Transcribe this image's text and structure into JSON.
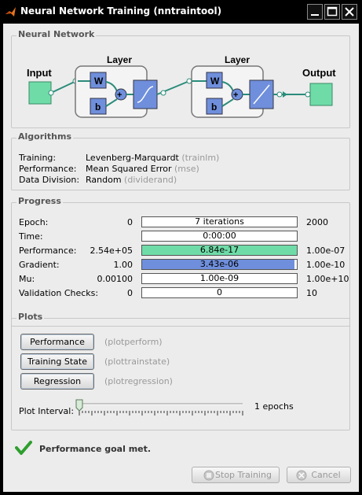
{
  "window": {
    "title": "Neural Network Training (nntraintool)"
  },
  "network": {
    "legend": "Neural Network",
    "input_label": "Input",
    "output_label": "Output",
    "layer1_label": "Layer",
    "layer2_label": "Layer",
    "weight_label": "W",
    "bias_label": "b"
  },
  "algorithms": {
    "legend": "Algorithms",
    "rows": [
      {
        "label": "Training:",
        "value": "Levenberg-Marquardt",
        "code": "(trainlm)"
      },
      {
        "label": "Performance:",
        "value": "Mean Squared Error",
        "code": "(mse)"
      },
      {
        "label": "Data Division:",
        "value": "Random",
        "code": "(dividerand)"
      }
    ]
  },
  "progress": {
    "legend": "Progress",
    "rows": [
      {
        "label": "Epoch:",
        "start": "0",
        "current": "7 iterations",
        "end": "2000",
        "fill": 0,
        "color": "#ffffff"
      },
      {
        "label": "Time:",
        "start": "",
        "current": "0:00:00",
        "end": "",
        "fill": 0,
        "color": "#ffffff"
      },
      {
        "label": "Performance:",
        "start": "2.54e+05",
        "current": "6.84e-17",
        "end": "1.00e-07",
        "fill": 1.0,
        "color": "#6fdca8"
      },
      {
        "label": "Gradient:",
        "start": "1.00",
        "current": "3.43e-06",
        "end": "1.00e-10",
        "fill": 0.985,
        "color": "#6f8fdc"
      },
      {
        "label": "Mu:",
        "start": "0.00100",
        "current": "1.00e-09",
        "end": "1.00e+10",
        "fill": 0,
        "color": "#ffffff"
      },
      {
        "label": "Validation Checks:",
        "start": "0",
        "current": "0",
        "end": "10",
        "fill": 0,
        "color": "#ffffff"
      }
    ]
  },
  "plots": {
    "legend": "Plots",
    "buttons": [
      {
        "label": "Performance",
        "code": "(plotperform)"
      },
      {
        "label": "Training State",
        "code": "(plottrainstate)"
      },
      {
        "label": "Regression",
        "code": "(plotregression)"
      }
    ],
    "interval_label": "Plot Interval:",
    "interval_value": "1 epochs",
    "slider_level": 0
  },
  "status": {
    "message": "Performance goal met.",
    "icon": "check-icon"
  },
  "footer": {
    "stop_label": "Stop Training",
    "cancel_label": "Cancel"
  }
}
